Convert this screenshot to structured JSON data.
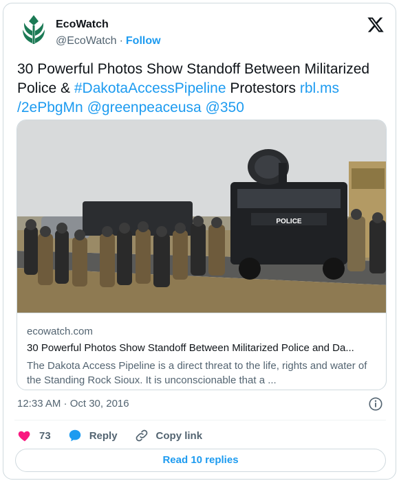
{
  "author": {
    "name": "EcoWatch",
    "handle": "@EcoWatch",
    "separator": "·",
    "follow_label": "Follow"
  },
  "tweet": {
    "text_part1": "30 Powerful Photos Show Standoff Between Militarized Police & ",
    "hashtag": "#DakotaAccessPipeline",
    "text_part2": " Protestors ",
    "link_url_1": "rbl.ms",
    "link_url_2": "/2ePbgMn",
    "mention_1": "@greenpeaceusa",
    "mention_2": "@350"
  },
  "link_card": {
    "domain": "ecowatch.com",
    "title": "30 Powerful Photos Show Standoff Between Militarized Police and Da...",
    "description": "The Dakota Access Pipeline is a direct threat to the life, rights and water of the Standing Rock Sioux. It is unconscionable that a ...",
    "vehicle_label": "POLICE"
  },
  "meta": {
    "timestamp": "12:33 AM · Oct 30, 2016"
  },
  "actions": {
    "like_count": "73",
    "reply_label": "Reply",
    "copy_link_label": "Copy link"
  },
  "read_replies_label": "Read 10 replies",
  "icons": {
    "avatar": "ecowatch-leaf-logo",
    "x": "x-logo-icon",
    "info": "info-icon",
    "like": "heart-icon",
    "reply": "chat-bubble-icon",
    "copy": "link-chain-icon"
  },
  "colors": {
    "accent": "#1d9bf0",
    "heart": "#f91880",
    "logo_green": "#1c7a55",
    "text": "#0f1419",
    "muted": "#536471"
  }
}
